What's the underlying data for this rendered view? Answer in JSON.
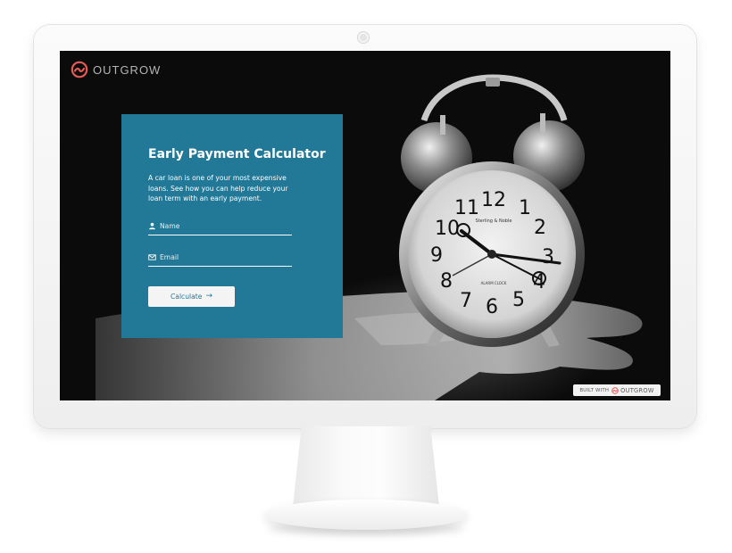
{
  "brand": {
    "name": "OUTGROW",
    "accent_color": "#e25a54",
    "logo_icon": "outgrow-logo-icon"
  },
  "calculator": {
    "title": "Early Payment Calculator",
    "description": "A car loan is one of your most expensive loans. See how you can help reduce your loan term with an early payment.",
    "card_color": "#227897",
    "name_field": {
      "placeholder": "Name",
      "value": "",
      "icon": "user-icon"
    },
    "email_field": {
      "placeholder": "Email",
      "value": "",
      "icon": "mail-icon"
    },
    "calculate_button": {
      "label": "Calculate",
      "icon": "arrow-right-icon"
    }
  },
  "badge": {
    "label": "BUILT WITH",
    "brand": "OUTGROW"
  },
  "hero_image": {
    "subject": "alarm-clock-on-hand",
    "clock_brand": "Sterling & Noble",
    "clock_sub": "ALARM CLOCK",
    "numerals": [
      "12",
      "1",
      "2",
      "3",
      "4",
      "5",
      "6",
      "7",
      "8",
      "9",
      "10",
      "11"
    ]
  }
}
